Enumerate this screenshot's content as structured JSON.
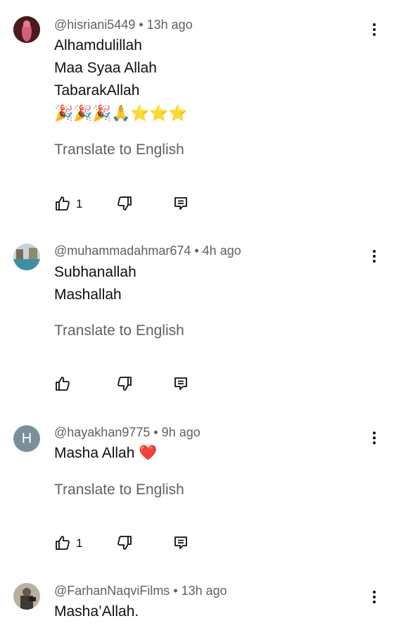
{
  "comments": [
    {
      "author": "@hisriani5449",
      "time": "13h ago",
      "meta": "@hisriani5449 • 13h ago",
      "lines": [
        "Alhamdulillah",
        "Maa Syaa Allah",
        "TabarakAllah"
      ],
      "emojis": [
        "🎉",
        "🎉",
        "🎉",
        "🙏",
        "⭐",
        "⭐",
        "⭐"
      ],
      "translate": "Translate to English",
      "likes": "1"
    },
    {
      "author": "@muhammadahmar674",
      "time": "4h ago",
      "meta": "@muhammadahmar674 • 4h ago",
      "lines": [
        "Subhanallah",
        "Mashallah"
      ],
      "translate": "Translate to English",
      "likes": ""
    },
    {
      "author": "@hayakhan9775",
      "time": "9h ago",
      "meta": "@hayakhan9775 • 9h ago",
      "avatar_letter": "H",
      "avatar_color": "#7a8f9c",
      "lines": [
        "Masha Allah ❤️"
      ],
      "translate": "Translate to English",
      "likes": "1"
    },
    {
      "author": "@FarhanNaqviFilms",
      "time": "13h ago",
      "meta": "@FarhanNaqviFilms • 13h ago",
      "lines": [
        "Masha’Allah."
      ]
    }
  ],
  "icons": {
    "like": "thumbs-up-icon",
    "dislike": "thumbs-down-icon",
    "reply": "reply-comment-icon",
    "more": "more-vertical-icon"
  }
}
